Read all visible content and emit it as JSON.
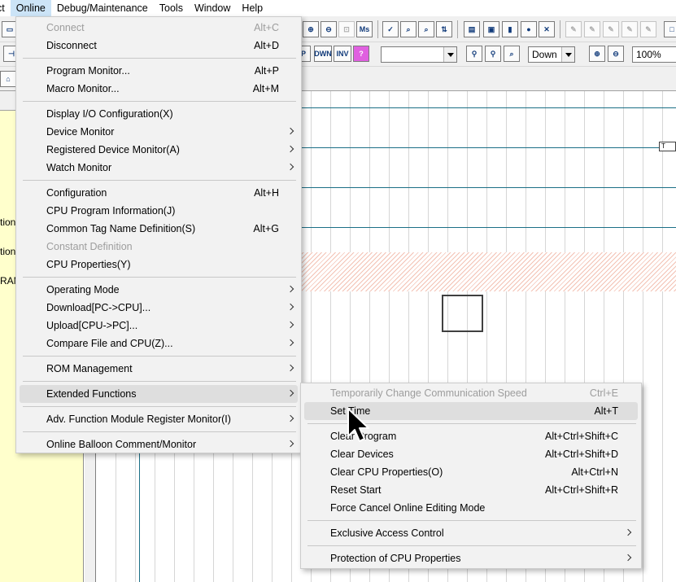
{
  "menubar": [
    {
      "label": "ct",
      "open": false
    },
    {
      "label": "Online",
      "open": true
    },
    {
      "label": "Debug/Maintenance",
      "open": false
    },
    {
      "label": "Tools",
      "open": false
    },
    {
      "label": "Window",
      "open": false
    },
    {
      "label": "Help",
      "open": false
    }
  ],
  "toolbar": {
    "ladder_buttons": [
      "P",
      "DWN",
      "INV",
      "?"
    ],
    "search_combo_value": "",
    "direction_combo_value": "Down",
    "zoom_combo_value": "100%"
  },
  "left_panel": {
    "fragments": [
      "tion",
      "tion",
      "RAM"
    ]
  },
  "editor": {
    "tag_box_text": "T"
  },
  "online_menu": {
    "items": [
      {
        "label": "Connect",
        "shortcut": "Alt+C",
        "disabled": true,
        "submenu": false
      },
      {
        "label": "Disconnect",
        "shortcut": "Alt+D",
        "disabled": false,
        "submenu": false
      },
      {
        "label": "Program Monitor...",
        "shortcut": "Alt+P",
        "disabled": false,
        "submenu": false
      },
      {
        "label": "Macro Monitor...",
        "shortcut": "Alt+M",
        "disabled": false,
        "submenu": false
      },
      {
        "label": "Display I/O Configuration(X)",
        "shortcut": "",
        "disabled": false,
        "submenu": false
      },
      {
        "label": "Device Monitor",
        "shortcut": "",
        "disabled": false,
        "submenu": true
      },
      {
        "label": "Registered Device Monitor(A)",
        "shortcut": "",
        "disabled": false,
        "submenu": true
      },
      {
        "label": "Watch Monitor",
        "shortcut": "",
        "disabled": false,
        "submenu": true
      },
      {
        "label": "Configuration",
        "shortcut": "Alt+H",
        "disabled": false,
        "submenu": false
      },
      {
        "label": "CPU Program Information(J)",
        "shortcut": "",
        "disabled": false,
        "submenu": false
      },
      {
        "label": "Common Tag Name Definition(S)",
        "shortcut": "Alt+G",
        "disabled": false,
        "submenu": false
      },
      {
        "label": "Constant Definition",
        "shortcut": "",
        "disabled": true,
        "submenu": false
      },
      {
        "label": "CPU Properties(Y)",
        "shortcut": "",
        "disabled": false,
        "submenu": false
      },
      {
        "label": "Operating Mode",
        "shortcut": "",
        "disabled": false,
        "submenu": true
      },
      {
        "label": "Download[PC->CPU]...",
        "shortcut": "",
        "disabled": false,
        "submenu": true
      },
      {
        "label": "Upload[CPU->PC]...",
        "shortcut": "",
        "disabled": false,
        "submenu": true
      },
      {
        "label": "Compare File and CPU(Z)...",
        "shortcut": "",
        "disabled": false,
        "submenu": true
      },
      {
        "label": "ROM Management",
        "shortcut": "",
        "disabled": false,
        "submenu": true
      },
      {
        "label": "Extended Functions",
        "shortcut": "",
        "disabled": false,
        "submenu": true,
        "highlighted": true
      },
      {
        "label": "Adv. Function Module Register Monitor(I)",
        "shortcut": "",
        "disabled": false,
        "submenu": true
      },
      {
        "label": "Online Balloon Comment/Monitor",
        "shortcut": "",
        "disabled": false,
        "submenu": true
      }
    ]
  },
  "extended_menu": {
    "items": [
      {
        "label": "Temporarily Change Communication Speed",
        "shortcut": "Ctrl+E",
        "disabled": true,
        "submenu": false
      },
      {
        "label": "Set Time",
        "shortcut": "Alt+T",
        "disabled": false,
        "submenu": false,
        "highlighted": true
      },
      {
        "label": "Clear Program",
        "shortcut": "Alt+Ctrl+Shift+C",
        "disabled": false,
        "submenu": false
      },
      {
        "label": "Clear Devices",
        "shortcut": "Alt+Ctrl+Shift+D",
        "disabled": false,
        "submenu": false
      },
      {
        "label": "Clear CPU Properties(O)",
        "shortcut": "Alt+Ctrl+N",
        "disabled": false,
        "submenu": false
      },
      {
        "label": "Reset Start",
        "shortcut": "Alt+Ctrl+Shift+R",
        "disabled": false,
        "submenu": false
      },
      {
        "label": "Force Cancel Online Editing Mode",
        "shortcut": "",
        "disabled": false,
        "submenu": false
      },
      {
        "label": "Exclusive Access Control",
        "shortcut": "",
        "disabled": false,
        "submenu": true
      },
      {
        "label": "Protection of CPU Properties",
        "shortcut": "",
        "disabled": false,
        "submenu": true
      }
    ]
  }
}
